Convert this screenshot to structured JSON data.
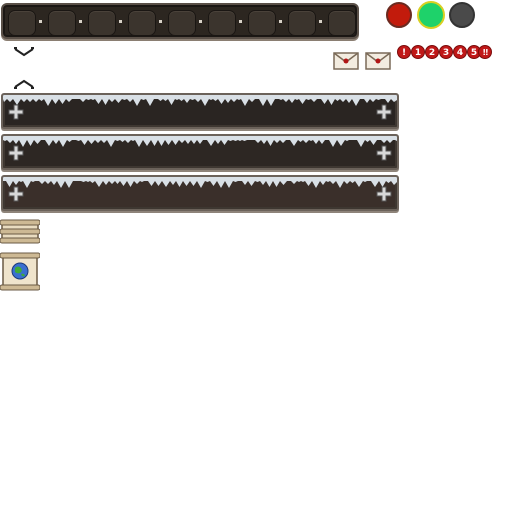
{
  "hotbar": {
    "slots": 9,
    "icon": "empty-slot"
  },
  "status_dots": [
    {
      "name": "red",
      "color": "#c21b0c"
    },
    {
      "name": "green",
      "color": "#1ed26a",
      "selected": true
    },
    {
      "name": "grey",
      "color": "#4a4a4a"
    }
  ],
  "chevrons": {
    "down_icon": "chevron-down-icon",
    "up_icon": "chevron-up-icon"
  },
  "mail": {
    "icon": "envelope-icon",
    "count": 2
  },
  "badges": {
    "labels": [
      "!",
      "1",
      "2",
      "3",
      "4",
      "5",
      "!!"
    ],
    "color": "#c01818"
  },
  "bars": [
    {
      "style": "snow",
      "shade": "#2a2522"
    },
    {
      "style": "snow",
      "shade": "#2d2723"
    },
    {
      "style": "snow",
      "shade": "#3a2f2a"
    }
  ],
  "scrolls": [
    {
      "icon": "scroll-closed-icon"
    },
    {
      "icon": "scroll-map-icon"
    }
  ]
}
